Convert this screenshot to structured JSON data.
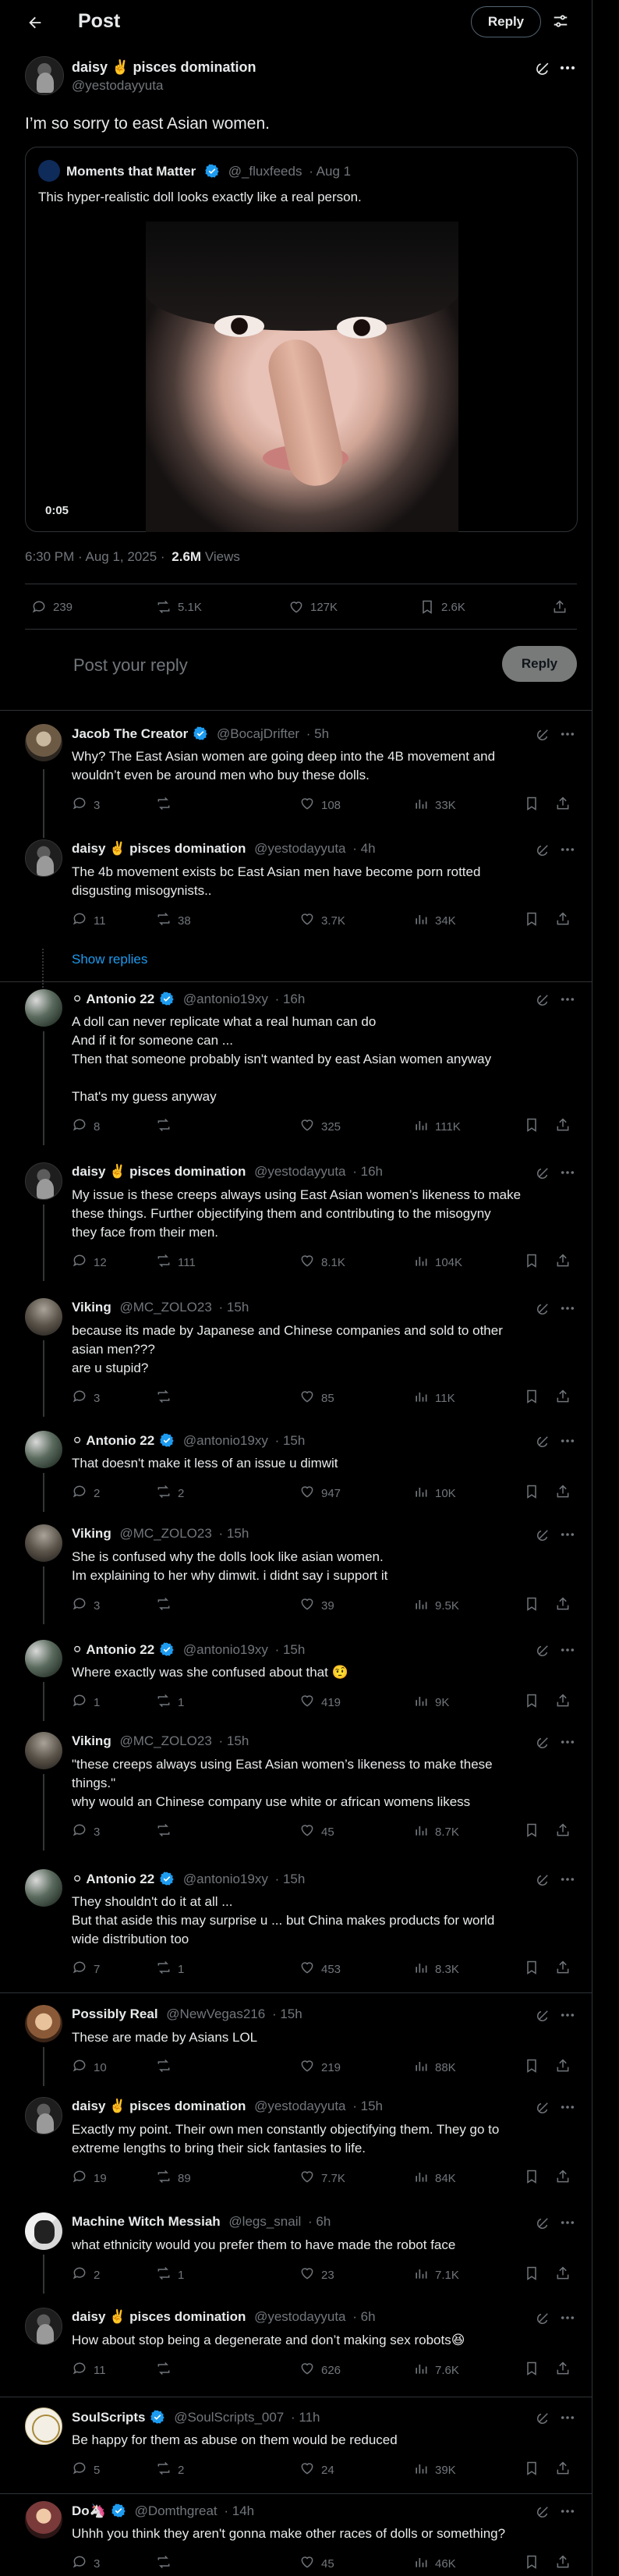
{
  "header": {
    "title": "Post",
    "reply_label": "Reply"
  },
  "main_post": {
    "name": "daisy ✌️ pisces domination",
    "handle": "@yestodayyuta",
    "text": "I’m so sorry to east Asian women.",
    "quote": {
      "name": "Moments that Matter",
      "handle": "@_fluxfeeds",
      "date": "· Aug 1",
      "text": "This hyper-realistic doll looks exactly like a real person.",
      "video_time": "0:05"
    },
    "timestamp": "6:30 PM · Aug 1, 2025 ·",
    "views_count": "2.6M",
    "views_label": "Views",
    "stats": {
      "replies": "239",
      "reposts": "5.1K",
      "likes": "127K",
      "bookmarks": "2.6K"
    }
  },
  "composer": {
    "placeholder": "Post your reply",
    "button": "Reply"
  },
  "show_replies": "Show replies",
  "replies": [
    {
      "name": "Jacob The Creator",
      "handle": "@BocajDrifter",
      "time": "· 5h",
      "lines": [
        "Why? The East Asian women are going deep into the 4B movement and",
        "wouldn’t even be around men who buy these dolls."
      ],
      "stats": {
        "replies": "3",
        "reposts": "",
        "likes": "108",
        "views": "33K"
      }
    },
    {
      "name": "daisy ✌️ pisces domination",
      "handle": "@yestodayyuta",
      "time": "· 4h",
      "lines": [
        "The 4b movement exists bc East Asian men have become porn rotted",
        "disgusting misogynists.."
      ],
      "stats": {
        "replies": "11",
        "reposts": "38",
        "likes": "3.7K",
        "views": "34K"
      }
    },
    {
      "name": "⚪ Antonio 22",
      "handle": "@antonio19xy",
      "time": "· 16h",
      "lines": [
        "A doll can never replicate what a real human can do",
        "And if it for someone can ...",
        "Then that someone probably isn't wanted by east Asian women anyway",
        "",
        "That's my guess anyway"
      ],
      "stats": {
        "replies": "8",
        "reposts": "",
        "likes": "325",
        "views": "111K"
      }
    },
    {
      "name": "daisy ✌️ pisces domination",
      "handle": "@yestodayyuta",
      "time": "· 16h",
      "lines": [
        "My issue is these creeps always using East Asian women’s likeness to make",
        "these things. Further objectifying them and contributing to the misogyny",
        "they face from their men."
      ],
      "stats": {
        "replies": "12",
        "reposts": "111",
        "likes": "8.1K",
        "views": "104K"
      }
    },
    {
      "name": "Viking",
      "handle": "@MC_ZOLO23",
      "time": "· 15h",
      "lines": [
        "because its made by Japanese and Chinese companies and sold to other",
        "asian men???",
        "are u stupid?"
      ],
      "stats": {
        "replies": "3",
        "reposts": "",
        "likes": "85",
        "views": "11K"
      }
    },
    {
      "name": "⚪ Antonio 22",
      "handle": "@antonio19xy",
      "time": "· 15h",
      "lines": [
        "That doesn't make it less of an issue u dimwit"
      ],
      "stats": {
        "replies": "2",
        "reposts": "2",
        "likes": "947",
        "views": "10K"
      }
    },
    {
      "name": "Viking",
      "handle": "@MC_ZOLO23",
      "time": "· 15h",
      "lines": [
        "She is confused why the dolls look like asian women.",
        "Im explaining to her why dimwit. i didnt say i support it"
      ],
      "stats": {
        "replies": "3",
        "reposts": "",
        "likes": "39",
        "views": "9.5K"
      }
    },
    {
      "name": "⚪ Antonio 22",
      "handle": "@antonio19xy",
      "time": "· 15h",
      "lines": [
        "Where exactly was she confused about that 🤨"
      ],
      "stats": {
        "replies": "1",
        "reposts": "1",
        "likes": "419",
        "views": "9K"
      }
    },
    {
      "name": "Viking",
      "handle": "@MC_ZOLO23",
      "time": "· 15h",
      "lines": [
        "\"these creeps always using East Asian women’s likeness to make these",
        "things.\"",
        "why would an Chinese company use white or african womens likess"
      ],
      "stats": {
        "replies": "3",
        "reposts": "",
        "likes": "45",
        "views": "8.7K"
      }
    },
    {
      "name": "⚪ Antonio 22",
      "handle": "@antonio19xy",
      "time": "· 15h",
      "lines": [
        "They shouldn't do it at all ...",
        "But that aside this may surprise u ... but China makes products for world",
        "wide distribution too"
      ],
      "stats": {
        "replies": "7",
        "reposts": "1",
        "likes": "453",
        "views": "8.3K"
      }
    },
    {
      "name": "Possibly Real",
      "handle": "@NewVegas216",
      "time": "· 15h",
      "lines": [
        "These are made by Asians LOL"
      ],
      "stats": {
        "replies": "10",
        "reposts": "",
        "likes": "219",
        "views": "88K"
      }
    },
    {
      "name": "daisy ✌️ pisces domination",
      "handle": "@yestodayyuta",
      "time": "· 15h",
      "lines": [
        "Exactly my point. Their own men constantly objectifying them. They go to",
        "extreme lengths to bring their sick fantasies to life."
      ],
      "stats": {
        "replies": "19",
        "reposts": "89",
        "likes": "7.7K",
        "views": "84K"
      }
    },
    {
      "name": "Machine Witch Messiah",
      "handle": "@legs_snail",
      "time": "· 6h",
      "lines": [
        "what ethnicity would you prefer them to have made the robot face"
      ],
      "stats": {
        "replies": "2",
        "reposts": "1",
        "likes": "23",
        "views": "7.1K"
      }
    },
    {
      "name": "daisy ✌️ pisces domination",
      "handle": "@yestodayyuta",
      "time": "· 6h",
      "lines": [
        "How about stop being a degenerate and don’t making sex robots😆"
      ],
      "stats": {
        "replies": "11",
        "reposts": "",
        "likes": "626",
        "views": "7.6K"
      }
    },
    {
      "name": "SoulScripts",
      "handle": "@SoulScripts_007",
      "time": "· 11h",
      "lines": [
        "Be happy for them as abuse on them would be reduced"
      ],
      "stats": {
        "replies": "5",
        "reposts": "2",
        "likes": "24",
        "views": "39K"
      }
    },
    {
      "name": "Do🦄",
      "handle": "@Domthgreat",
      "time": "· 14h",
      "lines": [
        "Uhhh you think they aren't gonna make other races of dolls or something?"
      ],
      "stats": {
        "replies": "3",
        "reposts": "",
        "likes": "45",
        "views": "46K"
      }
    }
  ],
  "colors": {
    "accent": "#1d9bf0",
    "muted": "#71767b",
    "border": "#2f3336",
    "background": "#000000"
  }
}
